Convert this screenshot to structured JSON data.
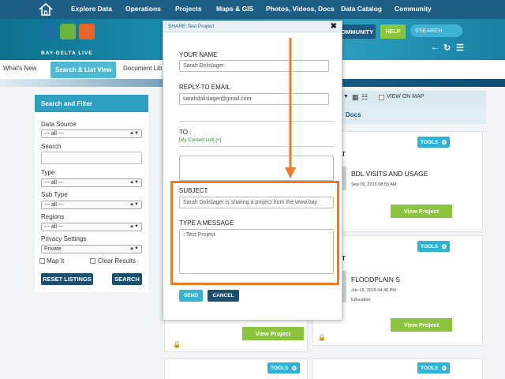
{
  "topnav": {
    "items": [
      "Explore Data",
      "Operations",
      "Projects",
      "Maps & GIS",
      "Photos, Videos, Docs",
      "Data Catalog",
      "Community"
    ]
  },
  "header": {
    "logo_text": "BAY-DELTA LIVE",
    "community_label": "COMMUNITY",
    "help_label": "HELP",
    "search_placeholder": "SEARCH"
  },
  "subtabs": {
    "items": [
      "What's New",
      "Search & List View",
      "Document Lib"
    ]
  },
  "filter": {
    "title": "Search and Filter",
    "data_source_label": "Data Source",
    "data_source_value": "--- all ---",
    "search_label": "Search",
    "type_label": "Type",
    "type_value": "--- all ---",
    "subtype_label": "Sub Type",
    "subtype_value": "--- all ---",
    "regions_label": "Regions",
    "regions_value": "--- all ---",
    "privacy_label": "Privacy Settings",
    "privacy_value": "Private",
    "map_it_label": "Map It",
    "clear_results_label": "Clear Results",
    "reset_label": "RESET LISTINGS",
    "search_button": "SEARCH"
  },
  "results": {
    "view_on_map_label": "VIEW ON MAP",
    "docs_label": "Docs",
    "tools_label": "TOOLS",
    "view_project_label": "View Project",
    "cards": [
      {
        "prefix": "T",
        "title": "BDL VISITS AND USAGE",
        "date": "Sep 09, 2015 08:59 AM",
        "category": ""
      },
      {
        "prefix": "T",
        "title": "FLOODPLAIN S",
        "date": "Jun 15, 2015 04:46 PM",
        "category": "Education"
      }
    ]
  },
  "modal": {
    "title": "SHARE:Test Project",
    "close_label": "✖",
    "your_name_label": "YOUR NAME",
    "your_name_value": "Sarah Dolislager",
    "reply_email_label": "REPLY-TO EMAIL",
    "reply_email_value": "sarahdolislager@gmail.com",
    "to_label": "TO :",
    "contact_list_label": "[My Contact List] [+]",
    "subject_label": "SUBJECT",
    "subject_value": "Sarah Dolislager is sharing a project from the www.bay",
    "message_label": "TYPE A MESSAGE",
    "message_value": "::Test Project",
    "send_label": "SEND",
    "cancel_label": "CANCEL"
  },
  "colors": {
    "nav_bg": "#1f5f86",
    "accent_teal": "#2fb3d5",
    "accent_green": "#8dc43f",
    "dark_button": "#1d4e6e",
    "annotation_orange": "#f07a26"
  }
}
